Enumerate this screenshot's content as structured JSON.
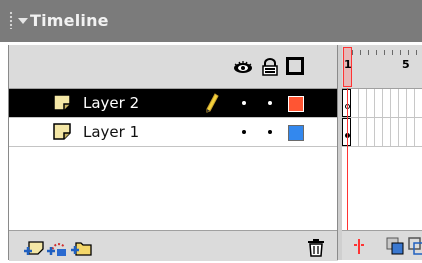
{
  "panel": {
    "title": "Timeline"
  },
  "header": {
    "icons": [
      "eye-icon",
      "lock-icon",
      "outline-icon"
    ]
  },
  "layers": [
    {
      "name": "Layer 2",
      "selected": true,
      "color": "#ff5533",
      "visible_dot": "•",
      "lock_dot": "•",
      "editing": true
    },
    {
      "name": "Layer 1",
      "selected": false,
      "color": "#3388ee",
      "visible_dot": "•",
      "lock_dot": "•",
      "editing": false
    }
  ],
  "footer": {
    "icons": [
      "insert-layer-icon",
      "add-motion-guide-icon",
      "insert-folder-icon",
      "delete-layer-icon"
    ]
  },
  "ruler": {
    "labels": [
      "1",
      "5"
    ]
  },
  "frames_footer": {
    "icons": [
      "center-frame-icon",
      "onion-skin-icon",
      "onion-skin-outlines-icon"
    ]
  },
  "colors": {
    "title_bar": "#7b7b7b",
    "header_bg": "#dbdbdb",
    "selected_row": "#000000",
    "playhead": "#ff3333"
  }
}
